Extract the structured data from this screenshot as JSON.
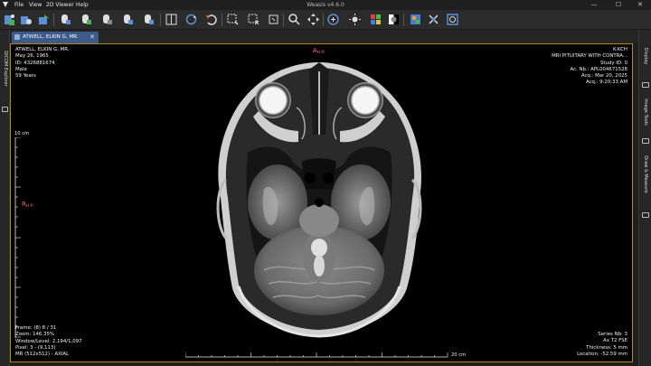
{
  "app": {
    "title": "Weasis v4.6.0",
    "menu": [
      "File",
      "View",
      "2D Viewer",
      "Help"
    ]
  },
  "window_buttons": {
    "minimize": "—",
    "maximize": "☐",
    "close": "✕"
  },
  "toolbar": {
    "icons": [
      "import-dicom-icon",
      "export-dicom-icon",
      "open-series-icon",
      "mouse-left-action-icon",
      "mouse-middle-action-icon",
      "mouse-right-action-icon",
      "mouse-wheel-action-icon",
      "layout-icon",
      "synchronise-icon",
      "reset-icon",
      "cine-icon",
      "measure-icon",
      "zoom-icon",
      "pan-icon",
      "window-level-icon",
      "brightness-icon",
      "lut-icon",
      "invert-icon",
      "color-palette-icon",
      "crosshair-icon",
      "series-sync-icon"
    ]
  },
  "left_dock": {
    "label": "DICOM Explorer"
  },
  "right_dock": {
    "panels": [
      "Display",
      "Image Tools",
      "Draw & Measure"
    ]
  },
  "tab": {
    "label": "ATWELL, ELKIN G, MR.",
    "close": "✕"
  },
  "overlay": {
    "top_left": [
      "ATWELL, ELKIN G, MR.",
      "May 26, 1965",
      "ID: 4326881674",
      "Male",
      "59 Years"
    ],
    "top_right": [
      "K-KCH",
      "MRI PITUITARY WITH CONTRA...",
      "Study ID: 0",
      "Ac. Nb.: APL004671528",
      "Acq.: Mar 20, 2025",
      "Acq.: 9:20:33 AM"
    ],
    "bottom_left": [
      "Frame: (8) 8 / 31",
      "Zoom: 146.35%",
      "Window/Level: 2,194/1,097",
      "Pixel: 3 - (9,113)",
      "MR (512x512) - AXIAL"
    ],
    "bottom_right": [
      "Series Nb: 3",
      "Ax T2 FSE",
      "Thickness: 5 mm",
      "Location: -52.59 mm"
    ]
  },
  "orientation": {
    "top": {
      "main": "A",
      "sub": "H-R"
    },
    "left": {
      "main": "R",
      "sub": "H-P"
    }
  },
  "ruler": {
    "vertical_label": "10 cm",
    "horizontal_label": "20 cm"
  },
  "colors": {
    "accent": "#3c5a8a",
    "viewer_border": "#b8860b",
    "orientation": "#ff6b6b"
  }
}
